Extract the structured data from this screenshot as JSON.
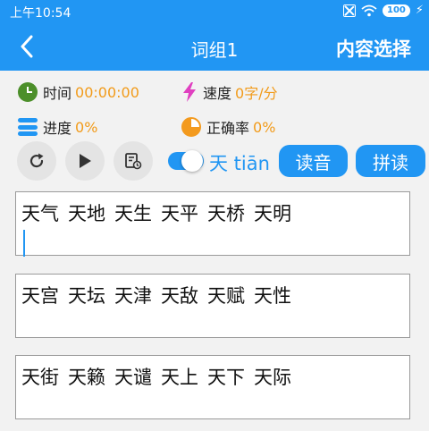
{
  "status_bar": {
    "time": "上午10:54",
    "battery": "100",
    "icons": [
      "no-sim-icon",
      "wifi-icon",
      "battery-icon",
      "charging-icon"
    ]
  },
  "header": {
    "title": "词组1",
    "action": "内容选择",
    "back_icon": "chevron-left-icon",
    "color": "#2196F3"
  },
  "stats": {
    "time_label": "时间",
    "time_value": "00:00:00",
    "speed_label": "速度",
    "speed_value": "0字/分",
    "progress_label": "进度",
    "progress_value": "0%",
    "accuracy_label": "正确率",
    "accuracy_value": "0%",
    "value_color": "#F29B1A"
  },
  "controls": {
    "icons": [
      "refresh-icon",
      "play-icon",
      "history-icon"
    ],
    "pinyin_toggle_on": true,
    "pinyin_preview": "天 tiān",
    "read_button": "读音",
    "spell_button": "拼读"
  },
  "word_groups": [
    {
      "words": [
        "天气",
        "天地",
        "天生",
        "天平",
        "天桥",
        "天明"
      ],
      "has_cursor": true
    },
    {
      "words": [
        "天宫",
        "天坛",
        "天津",
        "天敌",
        "天赋",
        "天性"
      ],
      "has_cursor": false
    },
    {
      "words": [
        "天街",
        "天籁",
        "天谴",
        "天上",
        "天下",
        "天际"
      ],
      "has_cursor": false
    }
  ]
}
